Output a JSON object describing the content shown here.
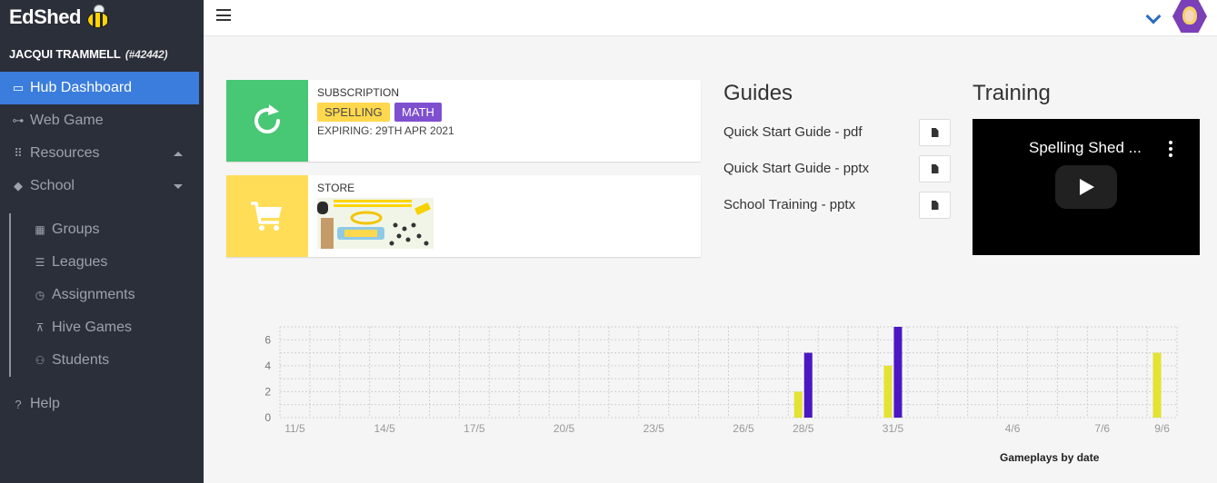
{
  "app": {
    "logo": "EdShed"
  },
  "user": {
    "name": "JACQUI TRAMMELL",
    "id": "(#42442)"
  },
  "sidebar": {
    "items": [
      {
        "label": "Hub Dashboard",
        "icon": "monitor-icon",
        "active": true
      },
      {
        "label": "Web Game",
        "icon": "gamepad-icon"
      },
      {
        "label": "Resources",
        "icon": "grid-icon"
      },
      {
        "label": "School",
        "icon": "graduation-cap-icon"
      }
    ],
    "school_items": [
      {
        "label": "Groups",
        "icon": "table-icon"
      },
      {
        "label": "Leagues",
        "icon": "list-icon"
      },
      {
        "label": "Assignments",
        "icon": "clock-icon"
      },
      {
        "label": "Hive Games",
        "icon": "sitemap-icon"
      },
      {
        "label": "Students",
        "icon": "users-icon"
      }
    ],
    "help": {
      "label": "Help",
      "icon": "question-icon"
    }
  },
  "subscription": {
    "title": "SUBSCRIPTION",
    "badges": [
      "SPELLING",
      "MATH"
    ],
    "expiry": "EXPIRING: 29TH APR 2021",
    "color": "#48c774"
  },
  "store": {
    "title": "STORE",
    "color": "#ffdd57"
  },
  "guides": {
    "title": "Guides",
    "items": [
      "Quick Start Guide - pdf",
      "Quick Start Guide - pptx",
      "School Training - pptx"
    ]
  },
  "training": {
    "title": "Training",
    "video_title": "Spelling Shed ..."
  },
  "chart_data": {
    "type": "bar",
    "categories": [
      "11/5",
      "12/5",
      "13/5",
      "14/5",
      "15/5",
      "16/5",
      "17/5",
      "18/5",
      "19/5",
      "20/5",
      "21/5",
      "22/5",
      "23/5",
      "24/5",
      "25/5",
      "26/5",
      "27/5",
      "28/5",
      "29/5",
      "30/5",
      "31/5",
      "1/6",
      "2/6",
      "3/6",
      "4/6",
      "5/6",
      "6/6",
      "7/6",
      "8/6",
      "9/6"
    ],
    "tick_labels": [
      "11/5",
      "14/5",
      "17/5",
      "20/5",
      "23/5",
      "26/5",
      "28/5",
      "31/5",
      "4/6",
      "7/6",
      "9/6"
    ],
    "series": [
      {
        "color": "#e3e334",
        "values": [
          0,
          0,
          0,
          0,
          0,
          0,
          0,
          0,
          0,
          0,
          0,
          0,
          0,
          0,
          0,
          0,
          0,
          2,
          0,
          0,
          4,
          0,
          0,
          0,
          0,
          0,
          0,
          0,
          0,
          5
        ]
      },
      {
        "color": "#4a17c2",
        "values": [
          0,
          0,
          0,
          0,
          0,
          0,
          0,
          0,
          0,
          0,
          0,
          0,
          0,
          0,
          0,
          0,
          0,
          5,
          0,
          0,
          7,
          0,
          0,
          0,
          0,
          0,
          0,
          0,
          0,
          0
        ]
      }
    ],
    "yticks": [
      0,
      2,
      4,
      6
    ],
    "ylim": [
      0,
      7
    ],
    "grid": true,
    "caption": "Gameplays by date"
  }
}
